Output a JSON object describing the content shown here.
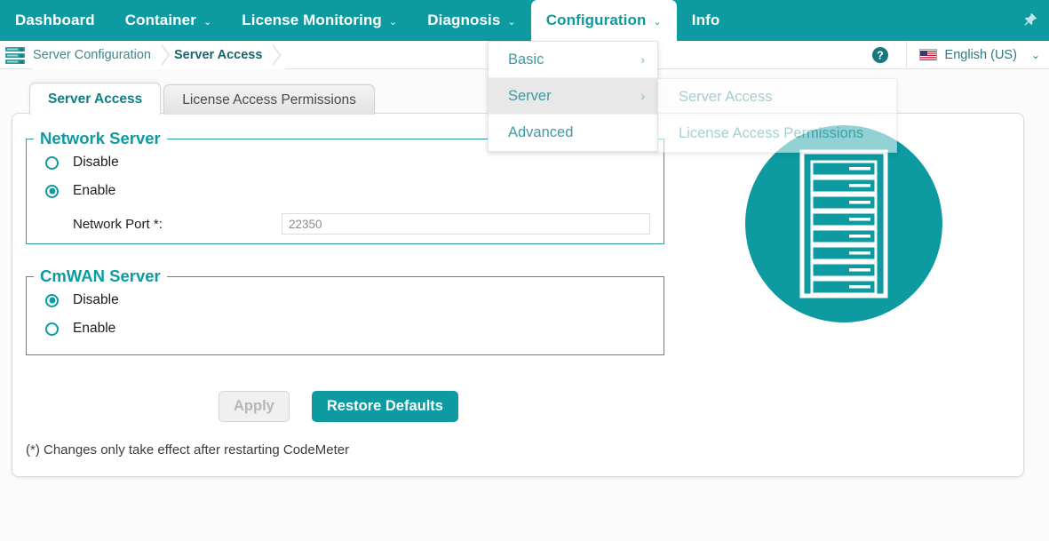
{
  "colors": {
    "brand_teal": "#0d9aa1",
    "legend_teal": "#0d9aa1",
    "menu_text": "#3f9ba1",
    "menu_highlight": "#e8e8e8",
    "panel_bg": "#ffffff",
    "page_bg": "#fbfbfb"
  },
  "topnav": {
    "items": [
      {
        "label": "Dashboard",
        "has_caret": false,
        "active": false
      },
      {
        "label": "Container",
        "has_caret": true,
        "active": false
      },
      {
        "label": "License Monitoring",
        "has_caret": true,
        "active": false
      },
      {
        "label": "Diagnosis",
        "has_caret": true,
        "active": false
      },
      {
        "label": "Configuration",
        "has_caret": true,
        "active": true
      },
      {
        "label": "Info",
        "has_caret": false,
        "active": false
      }
    ],
    "caret_glyph": "⌄",
    "pin_icon": "pushpin-icon"
  },
  "menu": {
    "main": [
      {
        "label": "Basic",
        "arrow": "›",
        "highlighted": false
      },
      {
        "label": "Server",
        "arrow": "›",
        "highlighted": true
      },
      {
        "label": "Advanced",
        "arrow": "",
        "highlighted": false
      }
    ],
    "sub": [
      {
        "label": "Server Access"
      },
      {
        "label": "License Access Permissions"
      }
    ]
  },
  "breadcrumb": {
    "icon": "server-stack-icon",
    "items": [
      {
        "label": "Server Configuration",
        "current": false
      },
      {
        "label": "Server Access",
        "current": true
      }
    ],
    "help_icon": "help-circle-icon",
    "language": {
      "flag": "us-flag-icon",
      "label": "English (US)",
      "caret": "⌄"
    }
  },
  "tabs": [
    {
      "label": "Server Access",
      "active": true
    },
    {
      "label": "License Access Permissions",
      "active": false
    }
  ],
  "form": {
    "network_server": {
      "legend": "Network Server",
      "options": [
        {
          "label": "Disable",
          "selected": false
        },
        {
          "label": "Enable",
          "selected": true
        }
      ],
      "port_label": "Network Port *:",
      "port_value": "22350",
      "port_placeholder": "22350"
    },
    "cmwan_server": {
      "legend": "CmWAN Server",
      "options": [
        {
          "label": "Disable",
          "selected": true
        },
        {
          "label": "Enable",
          "selected": false
        }
      ]
    },
    "buttons": {
      "apply": "Apply",
      "restore": "Restore Defaults"
    },
    "note": "(*) Changes only take effect after restarting CodeMeter"
  },
  "illustration": {
    "name": "server-rack-illustration",
    "slots": 8
  }
}
